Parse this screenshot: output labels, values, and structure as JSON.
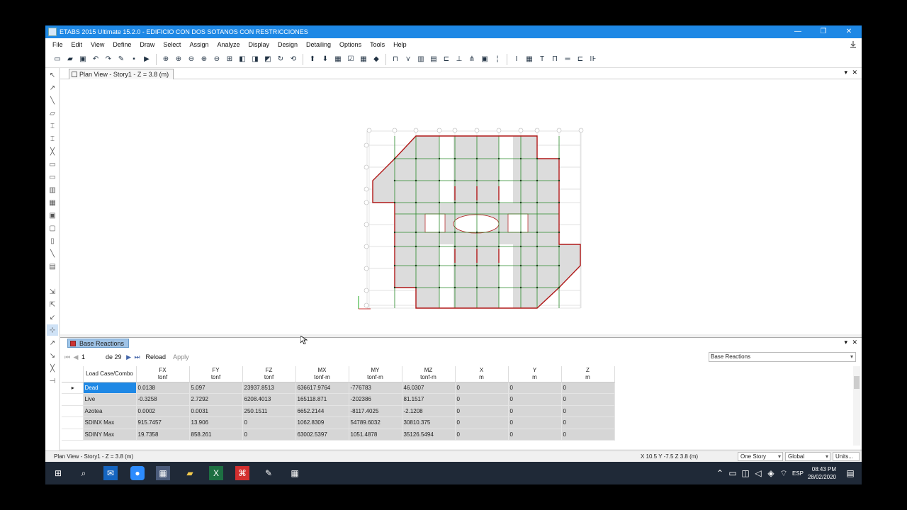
{
  "window": {
    "title": "ETABS 2015 Ultimate 15.2.0 - EDIFICIO CON DOS SOTANOS CON RESTRICCIONES",
    "minimize": "—",
    "restore": "❐",
    "close": "✕"
  },
  "menu": [
    "File",
    "Edit",
    "View",
    "Define",
    "Draw",
    "Select",
    "Assign",
    "Analyze",
    "Display",
    "Design",
    "Detailing",
    "Options",
    "Tools",
    "Help"
  ],
  "plan_view": {
    "tab_label": "Plan View - Story1 - Z = 3.8 (m)",
    "collapse": "▾",
    "close": "✕"
  },
  "reactions": {
    "tab_label": "Base Reactions",
    "nav": {
      "first": "⏮",
      "prev": "◀",
      "page": "1",
      "of_label": "de 29",
      "next": "▶",
      "last": "⏭",
      "reload": "Reload",
      "apply": "Apply"
    },
    "table_selector": "Base Reactions",
    "columns": [
      {
        "name": "Load Case/Combo",
        "unit": ""
      },
      {
        "name": "FX",
        "unit": "tonf"
      },
      {
        "name": "FY",
        "unit": "tonf"
      },
      {
        "name": "FZ",
        "unit": "tonf"
      },
      {
        "name": "MX",
        "unit": "tonf-m"
      },
      {
        "name": "MY",
        "unit": "tonf-m"
      },
      {
        "name": "MZ",
        "unit": "tonf-m"
      },
      {
        "name": "X",
        "unit": "m"
      },
      {
        "name": "Y",
        "unit": "m"
      },
      {
        "name": "Z",
        "unit": "m"
      }
    ],
    "rows": [
      [
        "Dead",
        "0.0138",
        "5.097",
        "23937.8513",
        "636617.9764",
        "-776783",
        "46.0307",
        "0",
        "0",
        "0"
      ],
      [
        "Live",
        "-0.3258",
        "2.7292",
        "6208.4013",
        "165118.871",
        "-202386",
        "81.1517",
        "0",
        "0",
        "0"
      ],
      [
        "Azotea",
        "0.0002",
        "0.0031",
        "250.1511",
        "6652.2144",
        "-8117.4025",
        "-2.1208",
        "0",
        "0",
        "0"
      ],
      [
        "SDINX Max",
        "915.7457",
        "13.906",
        "0",
        "1062.8309",
        "54789.6032",
        "30810.375",
        "0",
        "0",
        "0"
      ],
      [
        "SDINY Max",
        "19.7358",
        "858.261",
        "0",
        "63002.5397",
        "1051.4878",
        "35126.5494",
        "0",
        "0",
        "0"
      ]
    ],
    "selected_row_marker": "▸"
  },
  "status": {
    "view": "Plan View - Story1 - Z = 3.8 (m)",
    "coords": "X 10.5  Y -7.5  Z 3.8 (m)",
    "story_mode": "One Story",
    "coord_system": "Global",
    "units_button": "Units..."
  },
  "taskbar": {
    "lang": "ESP",
    "time": "08:43 PM",
    "date": "28/02/2020"
  }
}
